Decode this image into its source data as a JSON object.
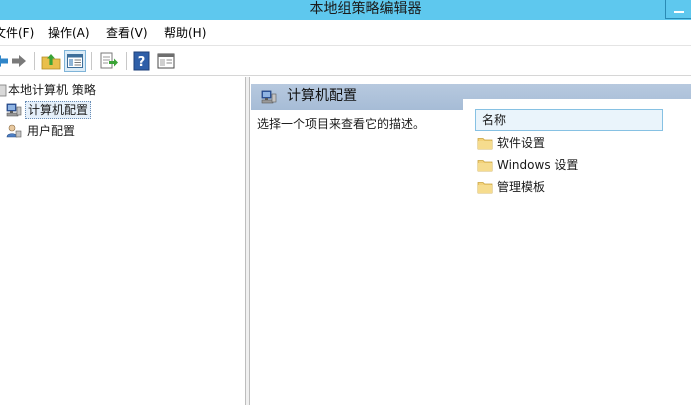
{
  "window": {
    "title": "本地组策略编辑器"
  },
  "menu": {
    "items": [
      {
        "label": "文件(F)"
      },
      {
        "label": "操作(A)"
      },
      {
        "label": "查看(V)"
      },
      {
        "label": "帮助(H)"
      }
    ]
  },
  "toolbar": {
    "buttons": [
      {
        "icon": "back-arrow-icon"
      },
      {
        "icon": "forward-arrow-icon"
      },
      {
        "icon": "up-folder-icon"
      },
      {
        "icon": "show-hide-tree-icon"
      },
      {
        "icon": "export-list-icon"
      },
      {
        "icon": "help-icon"
      },
      {
        "icon": "properties-view-icon"
      }
    ]
  },
  "tree": {
    "root_label": "本地计算机 策略",
    "items": [
      {
        "label": "计算机配置",
        "icon": "computer-config-icon",
        "selected": true
      },
      {
        "label": "用户配置",
        "icon": "user-config-icon",
        "selected": false
      }
    ]
  },
  "details": {
    "header_title": "计算机配置",
    "description": "选择一个项目来查看它的描述。",
    "column_name": "名称",
    "rows": [
      {
        "label": "软件设置",
        "icon": "folder-icon"
      },
      {
        "label": "Windows 设置",
        "icon": "folder-icon"
      },
      {
        "label": "管理模板",
        "icon": "folder-icon"
      }
    ]
  },
  "colors": {
    "titlebar": "#5ec8ee",
    "header_band": "#b7c9df",
    "column_header_border": "#86c1e3",
    "folder_yellow": "#f3d27a"
  }
}
